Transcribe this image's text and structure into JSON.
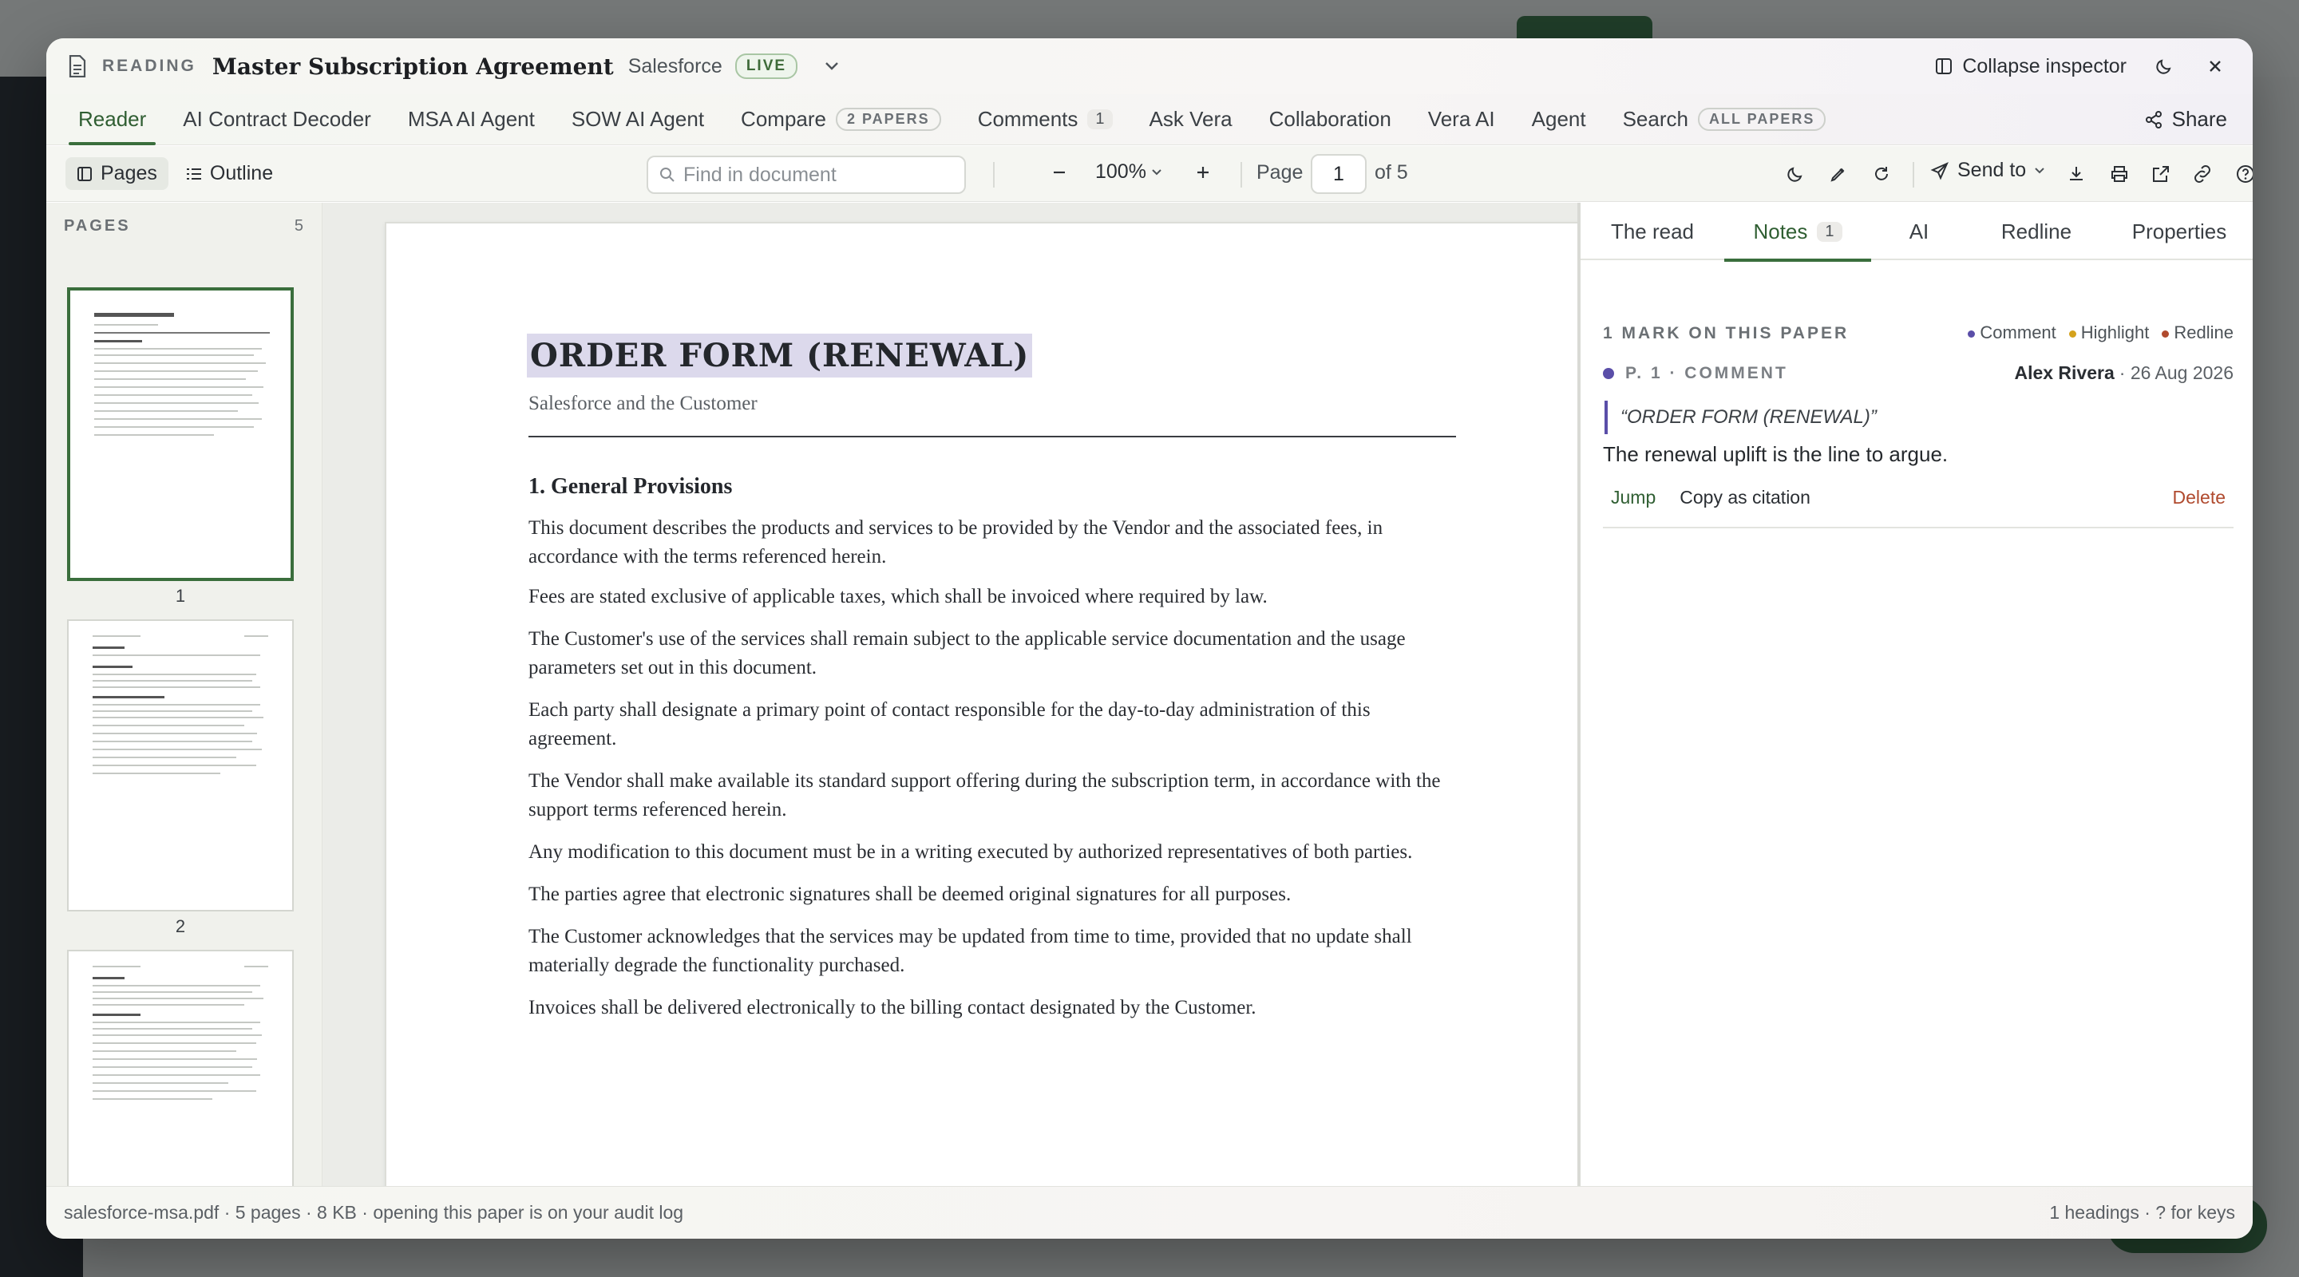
{
  "window": {
    "section_label": "READING",
    "title": "Master Subscription Agreement",
    "vendor": "Salesforce",
    "status": "LIVE",
    "collapse_label": "Collapse inspector"
  },
  "tabs": [
    {
      "label": "Reader",
      "badge": ""
    },
    {
      "label": "AI Contract Decoder",
      "badge": ""
    },
    {
      "label": "MSA AI Agent",
      "badge": ""
    },
    {
      "label": "SOW AI Agent",
      "badge": ""
    },
    {
      "label": "Compare",
      "badge": "2 PAPERS"
    },
    {
      "label": "Comments",
      "badge": "1"
    },
    {
      "label": "Ask Vera",
      "badge": ""
    },
    {
      "label": "Collaboration",
      "badge": ""
    },
    {
      "label": "Vera AI",
      "badge": ""
    },
    {
      "label": "Agent",
      "badge": ""
    },
    {
      "label": "Search",
      "badge": "ALL PAPERS"
    }
  ],
  "share_label": "Share",
  "toolbar": {
    "pages_label": "Pages",
    "outline_label": "Outline",
    "find_placeholder": "Find in document",
    "zoom": "100%",
    "page_label": "Page",
    "page_value": "1",
    "page_of": "of 5",
    "send_to_label": "Send to"
  },
  "pages_panel": {
    "heading": "PAGES",
    "count": "5",
    "page_numbers": [
      "1",
      "2"
    ]
  },
  "document": {
    "title": "ORDER FORM (RENEWAL)",
    "subtitle": "Salesforce and the Customer",
    "section": "1. General Provisions",
    "paragraphs": [
      "This document describes the products and services to be provided by the Vendor and the associated fees, in accordance with the terms referenced herein.",
      "Fees are stated exclusive of applicable taxes, which shall be invoiced where required by law.",
      "The Customer's use of the services shall remain subject to the applicable service documentation and the usage parameters set out in this document.",
      "Each party shall designate a primary point of contact responsible for the day-to-day administration of this agreement.",
      "The Vendor shall make available its standard support offering during the subscription term, in accordance with the support terms referenced herein.",
      "Any modification to this document must be in a writing executed by authorized representatives of both parties.",
      "The parties agree that electronic signatures shall be deemed original signatures for all purposes.",
      "The Customer acknowledges that the services may be updated from time to time, provided that no update shall materially degrade the functionality purchased.",
      "Invoices shall be delivered electronically to the billing contact designated by the Customer."
    ]
  },
  "inspector": {
    "tabs": [
      {
        "label": "The read",
        "badge": ""
      },
      {
        "label": "Notes",
        "badge": "1"
      },
      {
        "label": "AI",
        "badge": ""
      },
      {
        "label": "Redline",
        "badge": ""
      },
      {
        "label": "Properties",
        "badge": ""
      }
    ],
    "marks_heading": "1 MARK ON THIS PAPER",
    "legend": [
      {
        "label": "Comment",
        "color": "#5a4ea8"
      },
      {
        "label": "Highlight",
        "color": "#d4a21c"
      },
      {
        "label": "Redline",
        "color": "#b04a2e"
      }
    ],
    "note": {
      "tag": "P. 1 · COMMENT",
      "author": "Alex Rivera",
      "date": "· 26 Aug 2026",
      "quote": "“ORDER FORM (RENEWAL)”",
      "body": "The renewal uplift is the line to argue.",
      "actions": {
        "jump": "Jump",
        "copy": "Copy as citation",
        "delete": "Delete"
      }
    }
  },
  "status": {
    "left": "salesforce-msa.pdf · 5 pages · 8 KB · opening this paper is on your audit log",
    "right": "1 headings · ? for keys"
  },
  "colors": {
    "accent": "#3a6e3c",
    "comment": "#5a4ea8",
    "highlight": "#dcd9ec",
    "danger": "#b04a2e"
  }
}
